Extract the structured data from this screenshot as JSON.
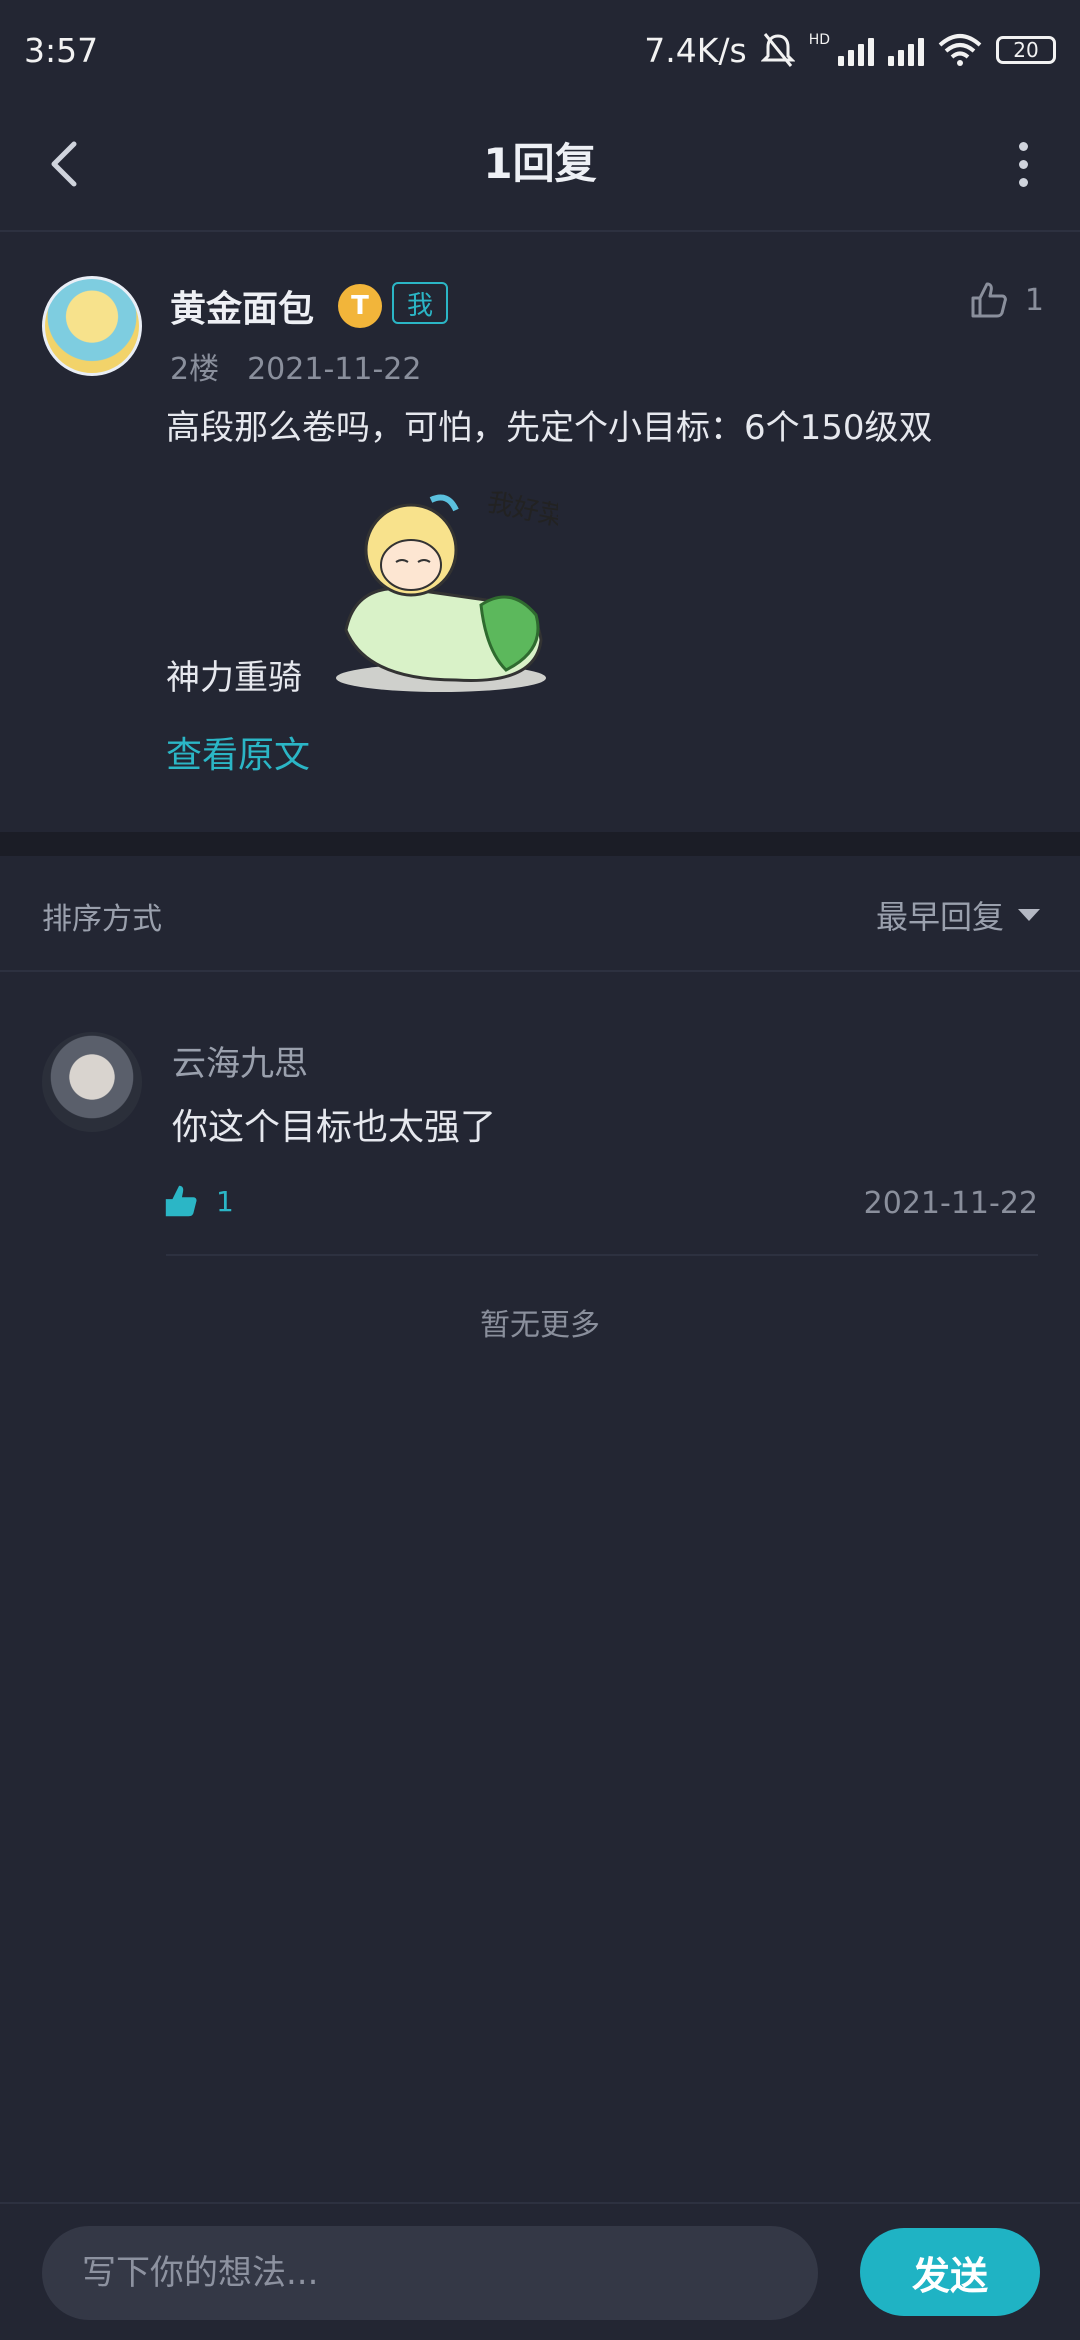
{
  "status_bar": {
    "time": "3:57",
    "net_speed": "7.4K/s",
    "hd_label": "HD",
    "battery": "20",
    "icons": [
      "bell-muted-icon",
      "signal-icon",
      "signal-icon",
      "wifi-icon",
      "battery-icon"
    ]
  },
  "header": {
    "title": "1回复",
    "back_icon": "back-arrow-icon",
    "more_icon": "more-vertical-icon"
  },
  "main_post": {
    "author": "黄金面包",
    "level_badge": "T",
    "me_badge": "我",
    "floor": "2楼",
    "date": "2021-11-22",
    "likes": "1",
    "text_line1": "高段那么卷吗，可怕，先定个小目标：6个150级双",
    "text_line2": "神力重骑",
    "sticker_text": "我好菜啊~",
    "view_original": "查看原文"
  },
  "sort": {
    "label": "排序方式",
    "selected": "最早回复"
  },
  "replies": [
    {
      "author": "云海九思",
      "text": "你这个目标也太强了",
      "likes": "1",
      "date": "2021-11-22"
    }
  ],
  "no_more": "暂无更多",
  "composer": {
    "placeholder": "写下你的想法...",
    "send_label": "发送"
  },
  "colors": {
    "background": "#232633",
    "accent": "#1fb3c4",
    "text_muted": "#8a8f9c"
  }
}
